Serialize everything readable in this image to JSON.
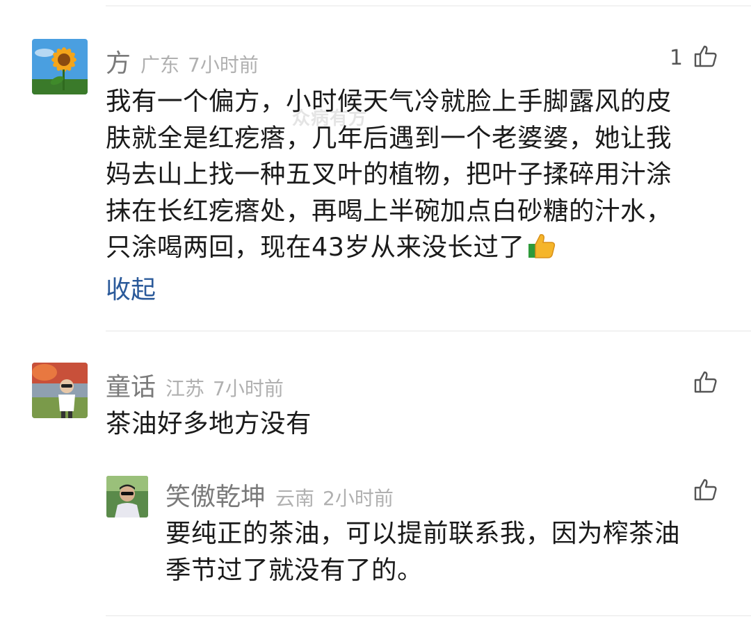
{
  "watermark": "众病有方",
  "comments": [
    {
      "name": "方",
      "location": "广东",
      "time": "7小时前",
      "likes": "1",
      "avatar_icon": "sunflower-avatar",
      "lines": [
        "我有一个偏方，小时候天气冷就脸上手脚露风的皮",
        "肤就全是红疙瘩，几年后遇到一个老婆婆，她让我",
        "妈去山上找一种五叉叶的植物，把叶子揉碎用汁涂",
        "抹在长红疙瘩处，再喝上半碗加点白砂糖的汁水，",
        "只涂喝两回，现在43岁从来没长过了"
      ],
      "emoji_icon": "thumbs-up-emoji",
      "collapse_label": "收起"
    },
    {
      "name": "童话",
      "location": "江苏",
      "time": "7小时前",
      "avatar_icon": "child-photo-avatar",
      "text": "茶油好多地方没有",
      "reply": {
        "name": "笑傲乾坤",
        "location": "云南",
        "time": "2小时前",
        "avatar_icon": "man-photo-avatar",
        "lines": [
          "要纯正的茶油，可以提前联系我，因为榨茶油",
          "季节过了就没有了的。"
        ]
      }
    }
  ],
  "colors": {
    "name": "#7a7a7a",
    "meta": "#b0b0b0",
    "text": "#1a1a1a",
    "link": "#2b5a9a",
    "divider": "#e6e6e6"
  }
}
